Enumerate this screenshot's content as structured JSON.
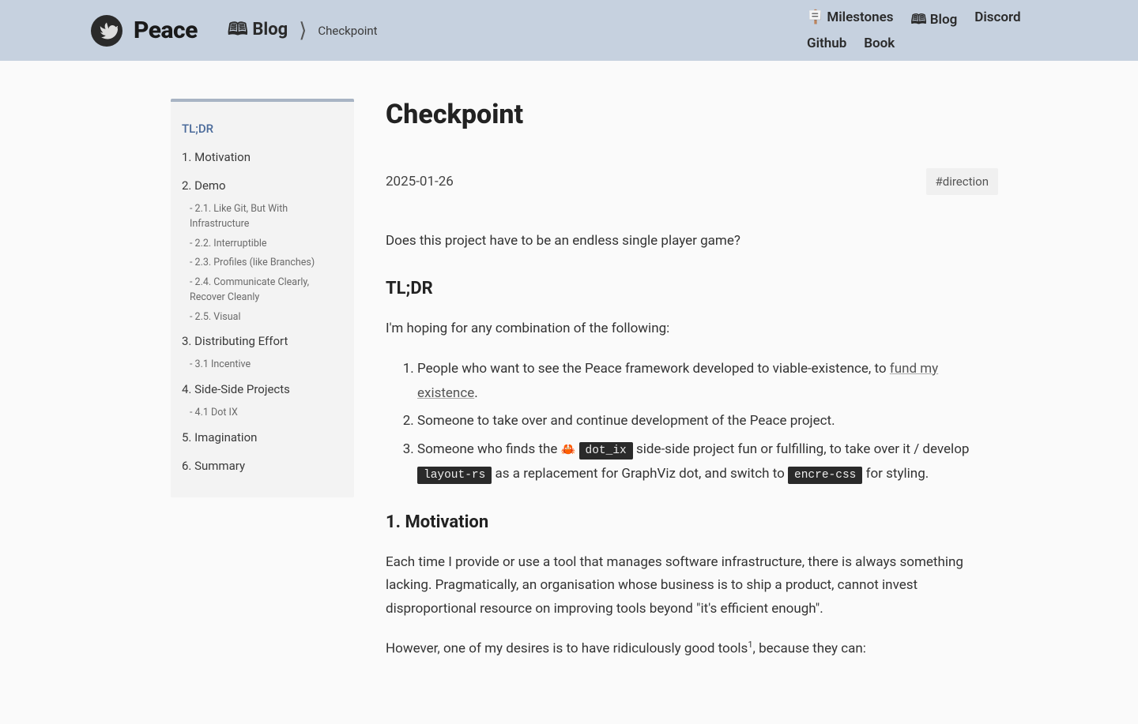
{
  "header": {
    "brand": "Peace",
    "breadcrumb": {
      "blog": "🕮 Blog",
      "current": "Checkpoint"
    },
    "nav": {
      "milestones": "🪧 Milestones",
      "blog": "🕮 Blog",
      "discord": "Discord",
      "github": "Github",
      "book": "Book"
    }
  },
  "sidebar": {
    "items": [
      {
        "label": "TL;DR",
        "active": true
      },
      {
        "label": "1. Motivation"
      },
      {
        "label": "2. Demo",
        "subs": [
          "- 2.1. Like Git, But With Infrastructure",
          "- 2.2. Interruptible",
          "- 2.3. Profiles (like Branches)",
          "- 2.4. Communicate Clearly, Recover Cleanly",
          "- 2.5. Visual"
        ]
      },
      {
        "label": "3. Distributing Effort",
        "subs": [
          "- 3.1 Incentive"
        ]
      },
      {
        "label": "4. Side-Side Projects",
        "subs": [
          "- 4.1 Dot IX"
        ]
      },
      {
        "label": "5. Imagination"
      },
      {
        "label": "6. Summary"
      }
    ]
  },
  "article": {
    "title": "Checkpoint",
    "date": "2025-01-26",
    "tag": "#direction",
    "lead": "Does this project have to be an endless single player game?",
    "tldr": {
      "heading": "TL;DR",
      "intro": "I'm hoping for any combination of the following:",
      "li1a": "People who want to see the Peace framework developed to viable-existence, to ",
      "li1_link": "fund my existence",
      "li1b": ".",
      "li2": "Someone to take over and continue development of the Peace project.",
      "li3a": "Someone who finds the ",
      "li3_code1": "dot_ix",
      "li3b": " side-side project fun or fulfilling, to take over it / develop ",
      "li3_code2": "layout-rs",
      "li3c": " as a replacement for GraphViz dot, and switch to ",
      "li3_code3": "encre-css",
      "li3d": " for styling."
    },
    "motivation": {
      "heading": "1. Motivation",
      "p1": "Each time I provide or use a tool that manages software infrastructure, there is always something lacking. Pragmatically, an organisation whose business is to ship a product, cannot invest disproportional resource on improving tools beyond \"it's efficient enough\".",
      "p2a": "However, one of my desires is to have ridiculously good tools",
      "p2_sup": "1",
      "p2b": ", because they can:"
    }
  }
}
